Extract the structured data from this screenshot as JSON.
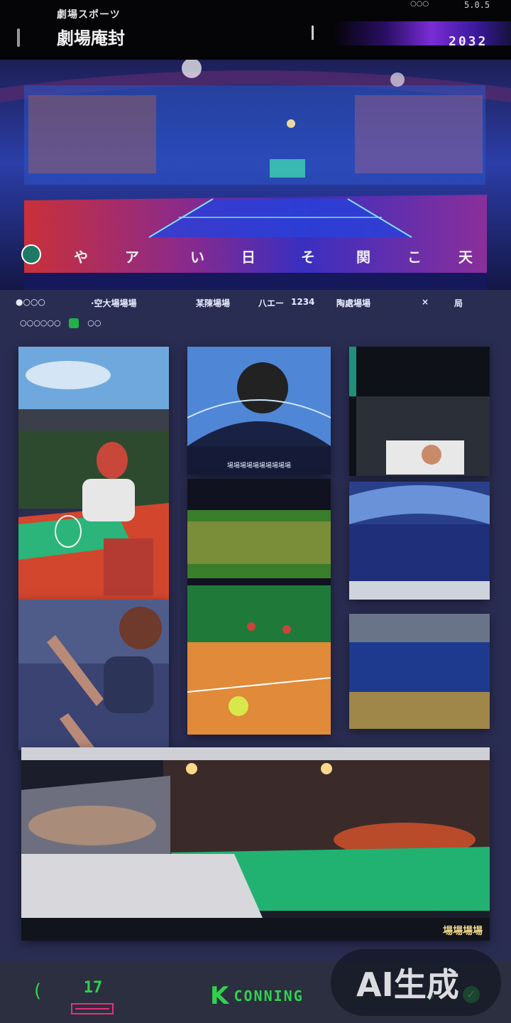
{
  "header": {
    "logo_line1": "劇場スポーツ",
    "logo_line2": "劇場庵封",
    "status": "○○○",
    "time": "5.0.5",
    "year": "2032"
  },
  "hero": {
    "nav": [
      "や",
      "ア",
      "い",
      "日",
      "そ",
      "関",
      "こ",
      "天"
    ]
  },
  "info_row": {
    "items": [
      "●○○○",
      "·空大場場場",
      "某陳場場",
      "八エー",
      "1234",
      "陶處場場",
      "×",
      "局"
    ],
    "row2_left": "○○○○○○",
    "row2_right": "○○"
  },
  "gallery": {
    "caption": "場場場場場場場場場場",
    "banner_caption": "場場場場"
  },
  "bottom_nav": {
    "back": "(",
    "num": "17",
    "coming_icon": "K",
    "coming": "CONNING",
    "ai_badge": "AI生成",
    "arrow": "➜",
    "check": "✓"
  }
}
